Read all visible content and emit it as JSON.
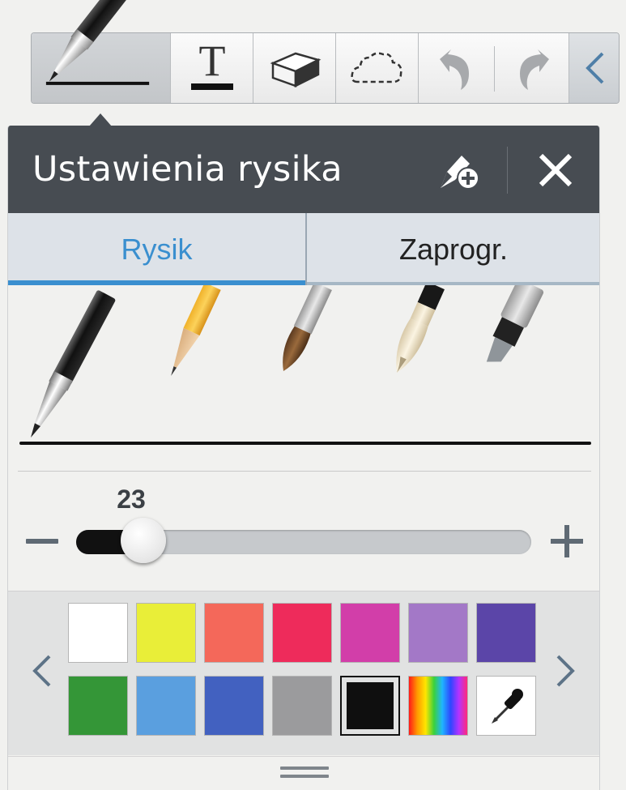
{
  "toolbar": {
    "tools": [
      {
        "name": "pen-tool",
        "icon": "pen-icon",
        "active": true
      },
      {
        "name": "text-tool",
        "icon": "text-icon",
        "active": false
      },
      {
        "name": "eraser-tool",
        "icon": "eraser-icon",
        "active": false
      },
      {
        "name": "lasso-tool",
        "icon": "lasso-icon",
        "active": false
      },
      {
        "name": "undo-tool",
        "icon": "undo-icon",
        "active": false
      },
      {
        "name": "redo-tool",
        "icon": "redo-icon",
        "active": false
      },
      {
        "name": "collapse-toolbar",
        "icon": "chevron-left-icon",
        "active": false
      }
    ]
  },
  "panel": {
    "title": "Ustawienia rysika",
    "add_preset_icon": "add-pen-preset-icon",
    "close_icon": "close-icon",
    "tabs": [
      {
        "label": "Rysik",
        "active": true
      },
      {
        "label": "Zaprogr.",
        "active": false
      }
    ],
    "pen_types": [
      "fountain-pen",
      "pencil",
      "brush",
      "chinese-brush",
      "marker"
    ],
    "selected_pen": "fountain-pen",
    "size": {
      "value": "23",
      "level": 0.12,
      "min_icon": "minus-icon",
      "max_icon": "plus-icon"
    },
    "palette": {
      "colors": [
        "#ffffff",
        "#e9ee38",
        "#f4685a",
        "#ee2b5b",
        "#d23ea9",
        "#a378c7",
        "#5b45a8",
        "#349637",
        "#5a9fdf",
        "#4261c0",
        "#9b9b9d",
        "#0f0f0f",
        "spectrum",
        "eyedropper"
      ],
      "selected_color": "#0f0f0f",
      "prev_icon": "chevron-left-icon",
      "next_icon": "chevron-right-icon"
    },
    "handle_icon": "drag-handle-icon"
  },
  "colors": {
    "header": "#474c52",
    "accent": "#3a8fcf",
    "tab_bg": "#dde2e8"
  }
}
